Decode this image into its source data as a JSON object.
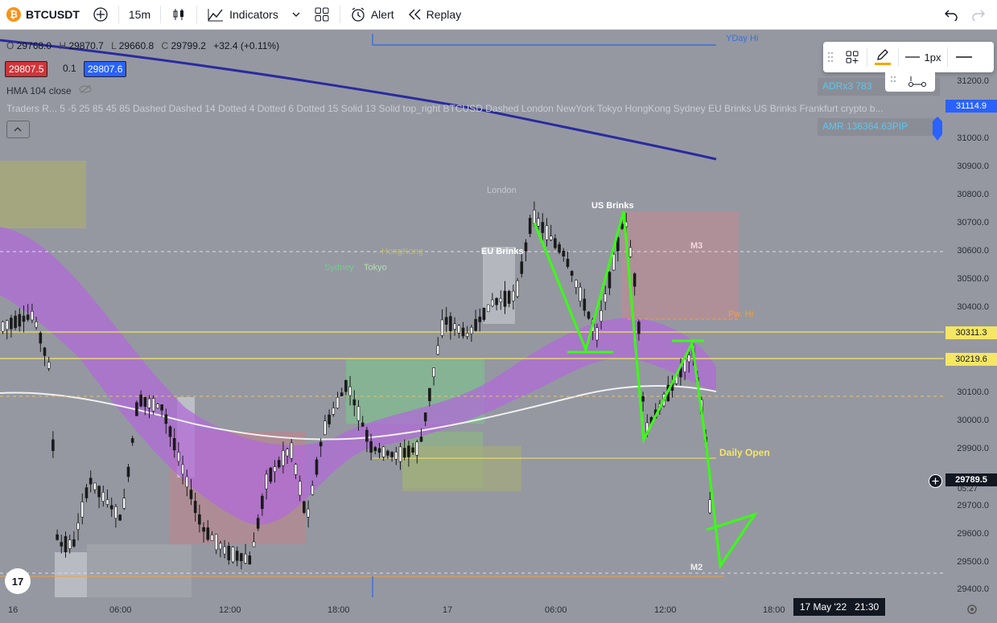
{
  "toolbar": {
    "symbol": "BTCUSDT",
    "interval": "15m",
    "indicators": "Indicators",
    "alert": "Alert",
    "replay": "Replay"
  },
  "legend": {
    "o_prefix": "O",
    "o": "29768.0",
    "h_prefix": "H",
    "h": "29870.7",
    "l_prefix": "L",
    "l": "29660.8",
    "c_prefix": "C",
    "c": "29799.2",
    "change": "+32.4 (+0.11%)",
    "bid": "29807.5",
    "spread": "0.1",
    "ask": "29807.6",
    "hma": "HMA 104 close",
    "traders": "Traders R...  5 -5 25 85 45 85 Dashed Dashed 14 Dotted 4 Dotted 6 Dotted 15 Solid 13 Solid top_right BTCUSD Dashed London NewYork Tokyo HongKong Sydney EU Brinks US Brinks Frankfurt crypto b..."
  },
  "chart_labels": {
    "yday_hi": "YDay Hi",
    "london": "London",
    "us_brinks": "US Brinks",
    "eu_brinks": "EU Brinks",
    "hongkong": "HongKong",
    "sydney": "Sydney",
    "tokyo": "Tokyo",
    "m3": "M3",
    "pw_hi": "Pw. Hi",
    "daily_open": "Daily Open",
    "m2": "M2",
    "adr": "ADRx3  783",
    "amr": "AMR    136364.63PIP"
  },
  "price_axis": [
    "31200.0",
    "31000.0",
    "30900.0",
    "30800.0",
    "30700.0",
    "30600.0",
    "30500.0",
    "30400.0",
    "30100.0",
    "30000.0",
    "29900.0",
    "29700.0",
    "29600.0",
    "29500.0",
    "29400.0"
  ],
  "price_boxes": {
    "top": "31114.9",
    "level1": "30311.3",
    "level2": "30219.6",
    "current": "29789.5",
    "countdown": "05:27"
  },
  "time_axis": [
    "16",
    "06:00",
    "12:00",
    "18:00",
    "17",
    "06:00",
    "12:00",
    "18:00"
  ],
  "time_cursor": "17 May '22   21:30",
  "floating_toolbar": {
    "width_label": "1px"
  },
  "colors": {
    "chart_bg": "#9598a1",
    "ribbon": "#b06bd8",
    "green_drawing": "#39ff14",
    "level_line": "#f5e663",
    "hma": "#2a2a9e"
  }
}
